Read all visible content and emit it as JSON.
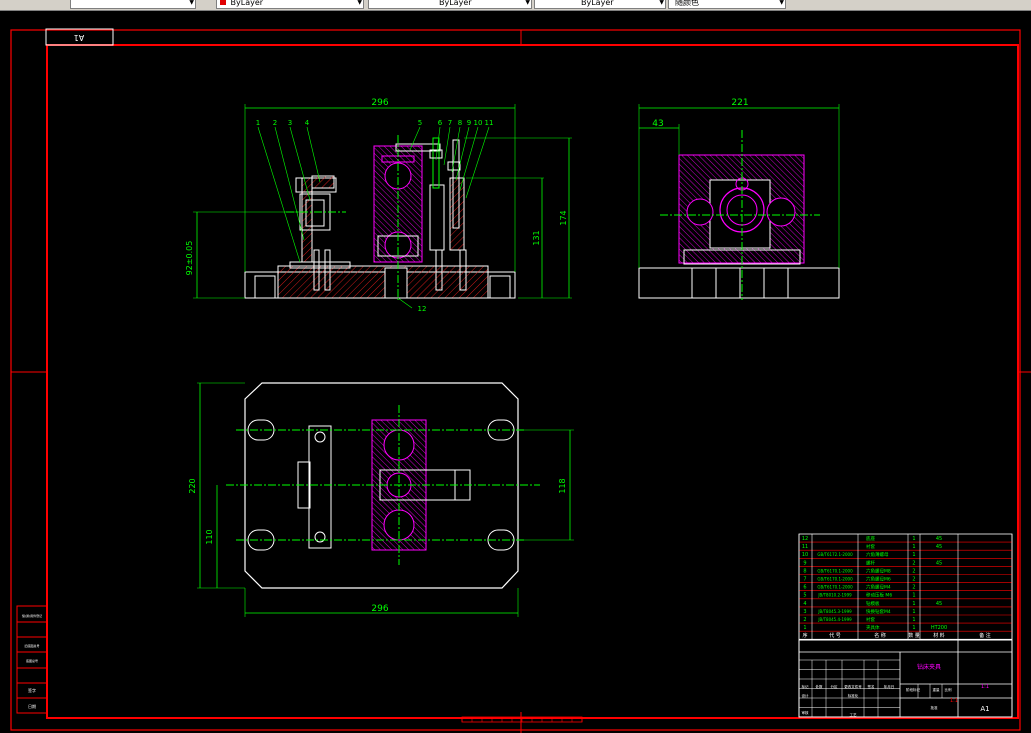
{
  "toolbar": {
    "combos": [
      {
        "id": "layer",
        "label": "",
        "has_swatch": false
      },
      {
        "id": "color",
        "label": "ByLayer",
        "has_swatch": true
      },
      {
        "id": "linetype",
        "label": "ByLayer",
        "has_swatch": false
      },
      {
        "id": "lineweight",
        "label": "ByLayer",
        "has_swatch": false
      },
      {
        "id": "plotstyle",
        "label": "随颜色",
        "has_swatch": false
      }
    ]
  },
  "colors": {
    "background": "#000000",
    "frame": "#ff0000",
    "geometry": "#ffffff",
    "dimension": "#00ff00",
    "hatch": "#ff0000",
    "workpiece": "#ff00ff",
    "centerline": "#00ff00"
  },
  "drawing": {
    "sheet_label": "A1",
    "front_view": {
      "width_dim": "296",
      "height_dims": [
        "131",
        "174",
        "92±0.05"
      ],
      "part_numbers": [
        "1",
        "2",
        "3",
        "4",
        "5",
        "6",
        "7",
        "8",
        "9",
        "10",
        "11",
        "12"
      ]
    },
    "side_view": {
      "width_dim": "221",
      "offset_dim": "43"
    },
    "top_view": {
      "width_dim": "296",
      "height_dims": [
        "220",
        "110",
        "118"
      ]
    },
    "bom_rows": [
      {
        "no": "12",
        "code": "",
        "name": "底座",
        "qty": "1",
        "mat": "45"
      },
      {
        "no": "11",
        "code": "",
        "name": "衬套",
        "qty": "1",
        "mat": "45"
      },
      {
        "no": "10",
        "code": "GB/T6172.1-2000",
        "name": "六角薄螺母",
        "qty": "1",
        "mat": ""
      },
      {
        "no": "9",
        "code": "",
        "name": "螺杆",
        "qty": "2",
        "mat": "45"
      },
      {
        "no": "8",
        "code": "GB/T6170.1-2000",
        "name": "六角螺母M8",
        "qty": "2",
        "mat": ""
      },
      {
        "no": "7",
        "code": "GB/T6170.1-2000",
        "name": "六角螺母M6",
        "qty": "2",
        "mat": ""
      },
      {
        "no": "6",
        "code": "GB/T6170.1-2000",
        "name": "六角螺母M4",
        "qty": "2",
        "mat": ""
      },
      {
        "no": "5",
        "code": "JB/T8010.2-1999",
        "name": "移动压板 M6",
        "qty": "1",
        "mat": ""
      },
      {
        "no": "4",
        "code": "",
        "name": "钻模板",
        "qty": "1",
        "mat": "45"
      },
      {
        "no": "3",
        "code": "JB/T8045.3-1999",
        "name": "快换钻套M4",
        "qty": "1",
        "mat": ""
      },
      {
        "no": "2",
        "code": "JB/T8045.4-1999",
        "name": "衬套",
        "qty": "1",
        "mat": ""
      },
      {
        "no": "1",
        "code": "",
        "name": "夹具体",
        "qty": "1",
        "mat": "HT200"
      }
    ],
    "bom_header": {
      "no": "序",
      "code": "代 号",
      "name": "名 称",
      "qty": "数 量",
      "mat": "材 料",
      "note": "备 注"
    },
    "title_block": {
      "title": "钻床夹具",
      "company": "",
      "scale": "1:1",
      "sheet": "A1",
      "tag": "1:1",
      "labels": [
        "标记",
        "处数",
        "分区",
        "更改文件号",
        "签名",
        "年月日",
        "设计",
        "标准化",
        "阶段标记",
        "重量",
        "比例",
        "审核",
        "工艺",
        "批准"
      ]
    },
    "side_strip": [
      "借(通)用件登记",
      "",
      "旧底图总号",
      "",
      "底图总号",
      "签字",
      "日期"
    ]
  }
}
